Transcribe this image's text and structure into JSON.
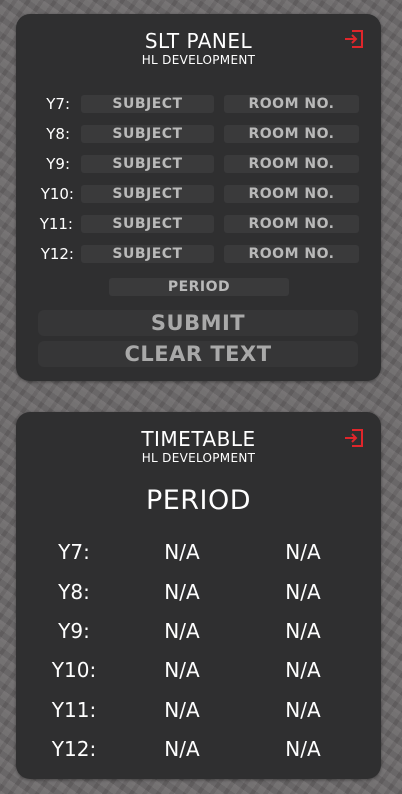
{
  "slt_panel": {
    "title": "SLT PANEL",
    "subtitle": "HL DEVELOPMENT",
    "exit_icon": "exit-icon",
    "rows": [
      {
        "label": "Y7:",
        "subject_placeholder": "SUBJECT",
        "room_placeholder": "ROOM NO."
      },
      {
        "label": "Y8:",
        "subject_placeholder": "SUBJECT",
        "room_placeholder": "ROOM NO."
      },
      {
        "label": "Y9:",
        "subject_placeholder": "SUBJECT",
        "room_placeholder": "ROOM NO."
      },
      {
        "label": "Y10:",
        "subject_placeholder": "SUBJECT",
        "room_placeholder": "ROOM NO."
      },
      {
        "label": "Y11:",
        "subject_placeholder": "SUBJECT",
        "room_placeholder": "ROOM NO."
      },
      {
        "label": "Y12:",
        "subject_placeholder": "SUBJECT",
        "room_placeholder": "ROOM NO."
      }
    ],
    "period_placeholder": "PERIOD",
    "submit_label": "SUBMIT",
    "clear_label": "CLEAR TEXT"
  },
  "timetable": {
    "title": "TIMETABLE",
    "subtitle": "HL DEVELOPMENT",
    "exit_icon": "exit-icon",
    "period_heading": "PERIOD",
    "rows": [
      {
        "label": "Y7:",
        "subject": "N/A",
        "room": "N/A"
      },
      {
        "label": "Y8:",
        "subject": "N/A",
        "room": "N/A"
      },
      {
        "label": "Y9:",
        "subject": "N/A",
        "room": "N/A"
      },
      {
        "label": "Y10:",
        "subject": "N/A",
        "room": "N/A"
      },
      {
        "label": "Y11:",
        "subject": "N/A",
        "room": "N/A"
      },
      {
        "label": "Y12:",
        "subject": "N/A",
        "room": "N/A"
      }
    ]
  },
  "colors": {
    "panel_bg": "#2f2f30",
    "field_bg": "#3a3a3b",
    "placeholder_text": "#b9b9b9",
    "exit_icon": "#e0262b"
  }
}
